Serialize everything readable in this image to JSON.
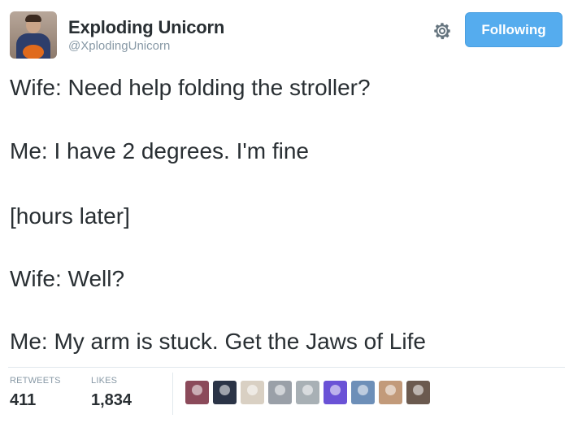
{
  "user": {
    "display_name": "Exploding Unicorn",
    "handle": "@XplodingUnicorn",
    "follow_label": "Following"
  },
  "tweet": {
    "lines": [
      "Wife: Need help folding the stroller?",
      "Me: I have 2 degrees. I'm fine",
      "[hours later]",
      "Wife: Well?",
      "Me: My arm is stuck. Get the Jaws of Life"
    ]
  },
  "stats": {
    "retweets_label": "RETWEETS",
    "retweets_value": "411",
    "likes_label": "LIKES",
    "likes_value": "1,834"
  },
  "icons": {
    "settings": "gear-icon"
  },
  "colors": {
    "follow_button": "#55acee",
    "text": "#292f33",
    "muted": "#8899a6"
  },
  "liker_avatar_colors": [
    "#8b4a5a",
    "#2b3447",
    "#d9d0c3",
    "#9aa0a8",
    "#a8b0b5",
    "#6a52d6",
    "#6d8fb8",
    "#c29a7a",
    "#6b5a4f"
  ]
}
